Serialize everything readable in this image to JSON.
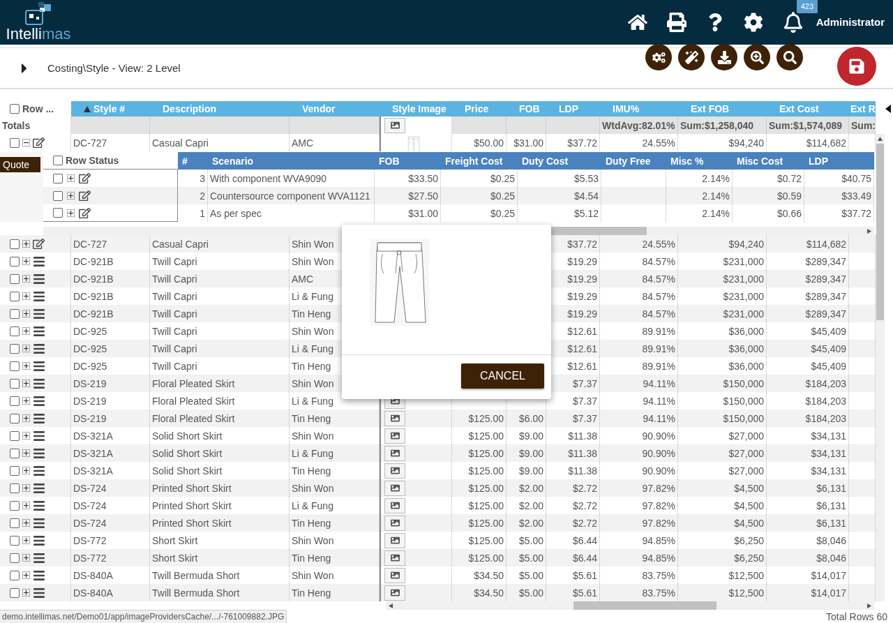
{
  "app": {
    "logo_text_a": "Intelli",
    "logo_text_b": "mas",
    "notification_count": "423",
    "user": "Administrator"
  },
  "toolbar": {
    "breadcrumb": "Costing\\Style - View: 2 Level"
  },
  "grid": {
    "header_checked": false,
    "columns": [
      {
        "label": "Row ...",
        "sorted": false
      },
      {
        "label": "Style #",
        "sorted": true
      },
      {
        "label": "Description",
        "sorted": false
      },
      {
        "label": "Vendor",
        "sorted": false
      },
      {
        "label": "Style Image",
        "sorted": false
      },
      {
        "label": "Price",
        "sorted": false
      },
      {
        "label": "FOB",
        "sorted": false
      },
      {
        "label": "LDP",
        "sorted": false
      },
      {
        "label": "IMU%",
        "sorted": false
      },
      {
        "label": "Ext FOB",
        "sorted": false
      },
      {
        "label": "Ext Cost",
        "sorted": false
      },
      {
        "label": "Ext R",
        "sorted": false
      }
    ],
    "totals": {
      "label": "Totals",
      "image": {
        "kind": "button"
      },
      "imu": "WtdAvg:82.01%",
      "ext_fob": "Sum:$1,258,040",
      "ext_cost": "Sum:$1,574,089",
      "ext_r": "Sum:"
    },
    "rows": [
      {
        "kind": "edit",
        "checked": false,
        "expanded": true,
        "style": "DC-727",
        "description": "Casual Capri",
        "vendor": "AMC",
        "image": {
          "kind": "thumbnail"
        },
        "price": "$50.00",
        "fob": "$31.00",
        "ldp": "$37.72",
        "imu": "24.55%",
        "ext_fob": "$94,240",
        "ext_cost": "$114,682",
        "sub_grid": {
          "label": "Quote",
          "header_checked": false,
          "columns": [
            "Row Status",
            "#",
            "Scenario",
            "FOB",
            "Freight Cost",
            "Duty Cost",
            "Duty Free",
            "Misc %",
            "Misc Cost",
            "LDP"
          ],
          "rows": [
            {
              "checked": false,
              "expanded": false,
              "number": "3",
              "scenario": "With component WVA9090",
              "fob": "$33.50",
              "freight": "$0.25",
              "duty": "$5.53",
              "misc_pct": "2.14%",
              "misc_cost": "$0.72",
              "ldp": "$40.75"
            },
            {
              "checked": false,
              "expanded": false,
              "number": "2",
              "scenario": "Countersource component WVA1121",
              "fob": "$27.50",
              "freight": "$0.25",
              "duty": "$4.54",
              "misc_pct": "2.14%",
              "misc_cost": "$0.59",
              "ldp": "$33.49"
            },
            {
              "checked": false,
              "expanded": false,
              "number": "1",
              "scenario": "As per spec",
              "fob": "$31.00",
              "freight": "$0.25",
              "duty": "$5.12",
              "misc_pct": "2.14%",
              "misc_cost": "$0.66",
              "ldp": "$37.72"
            }
          ]
        }
      },
      {
        "kind": "edit",
        "checked": false,
        "expanded": false,
        "style": "DC-727",
        "description": "Casual Capri",
        "vendor": "Shin Won",
        "ldp": "$37.72",
        "imu": "24.55%",
        "ext_fob": "$94,240",
        "ext_cost": "$114,682"
      },
      {
        "kind": "menu",
        "checked": false,
        "expanded": false,
        "style": "DC-921B",
        "description": "Twill Capri",
        "vendor": "Shin Won",
        "ldp": "$19.29",
        "imu": "84.57%",
        "ext_fob": "$231,000",
        "ext_cost": "$289,347"
      },
      {
        "kind": "menu",
        "checked": false,
        "expanded": false,
        "style": "DC-921B",
        "description": "Twill Capri",
        "vendor": "AMC",
        "ldp": "$19.29",
        "imu": "84.57%",
        "ext_fob": "$231,000",
        "ext_cost": "$289,347"
      },
      {
        "kind": "menu",
        "checked": false,
        "expanded": false,
        "style": "DC-921B",
        "description": "Twill Capri",
        "vendor": "Li & Fung",
        "ldp": "$19.29",
        "imu": "84.57%",
        "ext_fob": "$231,000",
        "ext_cost": "$289,347"
      },
      {
        "kind": "menu",
        "checked": false,
        "expanded": false,
        "style": "DC-921B",
        "description": "Twill Capri",
        "vendor": "Tin Heng",
        "ldp": "$19.29",
        "imu": "84.57%",
        "ext_fob": "$231,000",
        "ext_cost": "$289,347"
      },
      {
        "kind": "menu",
        "checked": false,
        "expanded": false,
        "style": "DC-925",
        "description": "Twill Capri",
        "vendor": "Shin Won",
        "ldp": "$12.61",
        "imu": "89.91%",
        "ext_fob": "$36,000",
        "ext_cost": "$45,409"
      },
      {
        "kind": "menu",
        "checked": false,
        "expanded": false,
        "style": "DC-925",
        "description": "Twill Capri",
        "vendor": "Li & Fung",
        "ldp": "$12.61",
        "imu": "89.91%",
        "ext_fob": "$36,000",
        "ext_cost": "$45,409"
      },
      {
        "kind": "menu",
        "checked": false,
        "expanded": false,
        "style": "DC-925",
        "description": "Twill Capri",
        "vendor": "Tin Heng",
        "ldp": "$12.61",
        "imu": "89.91%",
        "ext_fob": "$36,000",
        "ext_cost": "$45,409"
      },
      {
        "kind": "menu",
        "checked": false,
        "expanded": false,
        "style": "DS-219",
        "description": "Floral Pleated Skirt",
        "vendor": "Shin Won",
        "ldp": "$7.37",
        "imu": "94.11%",
        "ext_fob": "$150,000",
        "ext_cost": "$184,203"
      },
      {
        "kind": "menu",
        "checked": false,
        "expanded": false,
        "style": "DS-219",
        "description": "Floral Pleated Skirt",
        "vendor": "Li & Fung",
        "image": {
          "kind": "button"
        },
        "ldp": "$7.37",
        "imu": "94.11%",
        "ext_fob": "$150,000",
        "ext_cost": "$184,203"
      },
      {
        "kind": "menu",
        "checked": false,
        "expanded": false,
        "style": "DS-219",
        "description": "Floral Pleated Skirt",
        "vendor": "Tin Heng",
        "image": {
          "kind": "button"
        },
        "price": "$125.00",
        "fob": "$6.00",
        "ldp": "$7.37",
        "imu": "94.11%",
        "ext_fob": "$150,000",
        "ext_cost": "$184,203"
      },
      {
        "kind": "menu",
        "checked": false,
        "expanded": false,
        "style": "DS-321A",
        "description": "Solid Short Skirt",
        "vendor": "Shin Won",
        "image": {
          "kind": "button"
        },
        "price": "$125.00",
        "fob": "$9.00",
        "ldp": "$11.38",
        "imu": "90.90%",
        "ext_fob": "$27,000",
        "ext_cost": "$34,131"
      },
      {
        "kind": "menu",
        "checked": false,
        "expanded": false,
        "style": "DS-321A",
        "description": "Solid Short Skirt",
        "vendor": "Li & Fung",
        "image": {
          "kind": "button"
        },
        "price": "$125.00",
        "fob": "$9.00",
        "ldp": "$11.38",
        "imu": "90.90%",
        "ext_fob": "$27,000",
        "ext_cost": "$34,131"
      },
      {
        "kind": "menu",
        "checked": false,
        "expanded": false,
        "style": "DS-321A",
        "description": "Solid Short Skirt",
        "vendor": "Tin Heng",
        "image": {
          "kind": "button"
        },
        "price": "$125.00",
        "fob": "$9.00",
        "ldp": "$11.38",
        "imu": "90.90%",
        "ext_fob": "$27,000",
        "ext_cost": "$34,131"
      },
      {
        "kind": "menu",
        "checked": false,
        "expanded": false,
        "style": "DS-724",
        "description": "Printed Short Skirt",
        "vendor": "Shin Won",
        "image": {
          "kind": "button"
        },
        "price": "$125.00",
        "fob": "$2.00",
        "ldp": "$2.72",
        "imu": "97.82%",
        "ext_fob": "$4,500",
        "ext_cost": "$6,131"
      },
      {
        "kind": "menu",
        "checked": false,
        "expanded": false,
        "style": "DS-724",
        "description": "Printed Short Skirt",
        "vendor": "Li & Fung",
        "image": {
          "kind": "button"
        },
        "price": "$125.00",
        "fob": "$2.00",
        "ldp": "$2.72",
        "imu": "97.82%",
        "ext_fob": "$4,500",
        "ext_cost": "$6,131"
      },
      {
        "kind": "menu",
        "checked": false,
        "expanded": false,
        "style": "DS-724",
        "description": "Printed Short Skirt",
        "vendor": "Tin Heng",
        "image": {
          "kind": "button"
        },
        "price": "$125.00",
        "fob": "$2.00",
        "ldp": "$2.72",
        "imu": "97.82%",
        "ext_fob": "$4,500",
        "ext_cost": "$6,131"
      },
      {
        "kind": "menu",
        "checked": false,
        "expanded": false,
        "style": "DS-772",
        "description": "Short Skirt",
        "vendor": "Shin Won",
        "image": {
          "kind": "button"
        },
        "price": "$125.00",
        "fob": "$5.00",
        "ldp": "$6.44",
        "imu": "94.85%",
        "ext_fob": "$6,250",
        "ext_cost": "$8,046"
      },
      {
        "kind": "menu",
        "checked": false,
        "expanded": false,
        "style": "DS-772",
        "description": "Short Skirt",
        "vendor": "Tin Heng",
        "image": {
          "kind": "button"
        },
        "price": "$125.00",
        "fob": "$5.00",
        "ldp": "$6.44",
        "imu": "94.85%",
        "ext_fob": "$6,250",
        "ext_cost": "$8,046"
      },
      {
        "kind": "menu",
        "checked": false,
        "expanded": false,
        "style": "DS-840A",
        "description": "Twill Bermuda Short",
        "vendor": "Shin Won",
        "image": {
          "kind": "button"
        },
        "price": "$34.50",
        "fob": "$5.00",
        "ldp": "$5.61",
        "imu": "83.75%",
        "ext_fob": "$12,500",
        "ext_cost": "$14,017"
      },
      {
        "kind": "menu",
        "checked": false,
        "expanded": false,
        "style": "DS-840A",
        "description": "Twill Bermuda Short",
        "vendor": "Tin Heng",
        "image": {
          "kind": "button"
        },
        "price": "$34.50",
        "fob": "$5.00",
        "ldp": "$5.61",
        "imu": "83.75%",
        "ext_fob": "$12,500",
        "ext_cost": "$14,017"
      }
    ]
  },
  "dialog": {
    "button": "CANCEL"
  },
  "status_bar": {
    "url": "demo.intellimas.net/Demo01/app/imageProvidersCache/.../-761009882.JPG",
    "total": "Total Rows 60"
  }
}
